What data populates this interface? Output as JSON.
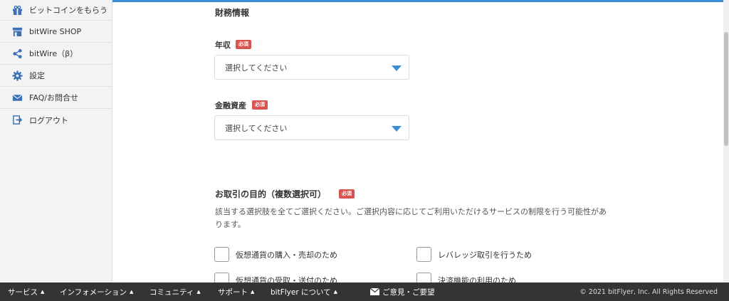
{
  "sidebar": {
    "items": [
      {
        "label": "ビットコインをもらう",
        "icon": "gift-icon"
      },
      {
        "label": "bitWire SHOP",
        "icon": "shop-icon"
      },
      {
        "label": "bitWire（β）",
        "icon": "share-icon"
      },
      {
        "label": "設定",
        "icon": "gear-icon"
      },
      {
        "label": "FAQ/お問合せ",
        "icon": "mail-icon"
      },
      {
        "label": "ログアウト",
        "icon": "logout-icon"
      }
    ]
  },
  "form": {
    "section_title": "財務情報",
    "required_badge": "必須",
    "annual_income": {
      "label": "年収",
      "value": "選択してください"
    },
    "financial_assets": {
      "label": "金融資産",
      "value": "選択してください"
    },
    "purpose": {
      "label": "お取引の目的（複数選択可）",
      "description_line1": "該当する選択肢を全てご選択ください。ご選択内容に応じてご利用いただけるサービスの制限を行う可能性があ",
      "description_line2": "ります。",
      "options": [
        "仮想通貨の購入・売却のため",
        "レバレッジ取引を行うため",
        "仮想通貨の受取・送付のため",
        "決済機能の利用のため"
      ]
    }
  },
  "footer": {
    "nav": [
      "サービス",
      "インフォメーション",
      "コミュニティ",
      "サポート",
      "bitFlyer について"
    ],
    "feedback": "ご意見・ご要望",
    "copyright": "© 2021 bitFlyer, Inc. All Rights Reserved"
  },
  "colors": {
    "accent": "#3b8fd6",
    "required": "#d9534f",
    "footer_bg": "#343434"
  }
}
